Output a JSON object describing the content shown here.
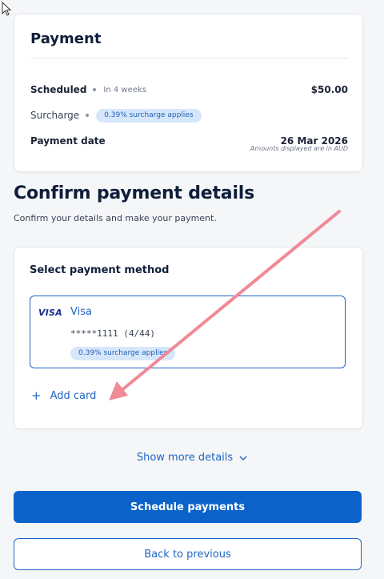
{
  "summary": {
    "title": "Payment",
    "scheduled_label": "Scheduled",
    "scheduled_sub": "In 4 weeks",
    "scheduled_amount": "$50.00",
    "surcharge_label": "Surcharge",
    "surcharge_pill": "0.39% surcharge applies",
    "date_label": "Payment date",
    "date_value": "26 Mar 2026",
    "currency_note": "Amounts displayed are in AUD"
  },
  "confirm": {
    "heading": "Confirm payment details",
    "subheading": "Confirm your details and make your payment."
  },
  "method": {
    "title": "Select payment method",
    "card": {
      "brand_logo": "VISA",
      "brand_name": "Visa",
      "number": "*****1111 (4/44)",
      "surcharge_pill": "0.39% surcharge applies"
    },
    "add_card_label": "Add card"
  },
  "show_more_label": "Show more details",
  "buttons": {
    "schedule": "Schedule payments",
    "back": "Back to previous"
  },
  "colors": {
    "accent": "#0b63c9",
    "pill_bg": "#d7e7fb",
    "annotation_arrow": "#f08a96"
  },
  "icons": {
    "add": "plus-icon",
    "chevron": "chevron-down-icon",
    "cursor": "mouse-cursor-icon",
    "annotation": "annotation-arrow"
  }
}
